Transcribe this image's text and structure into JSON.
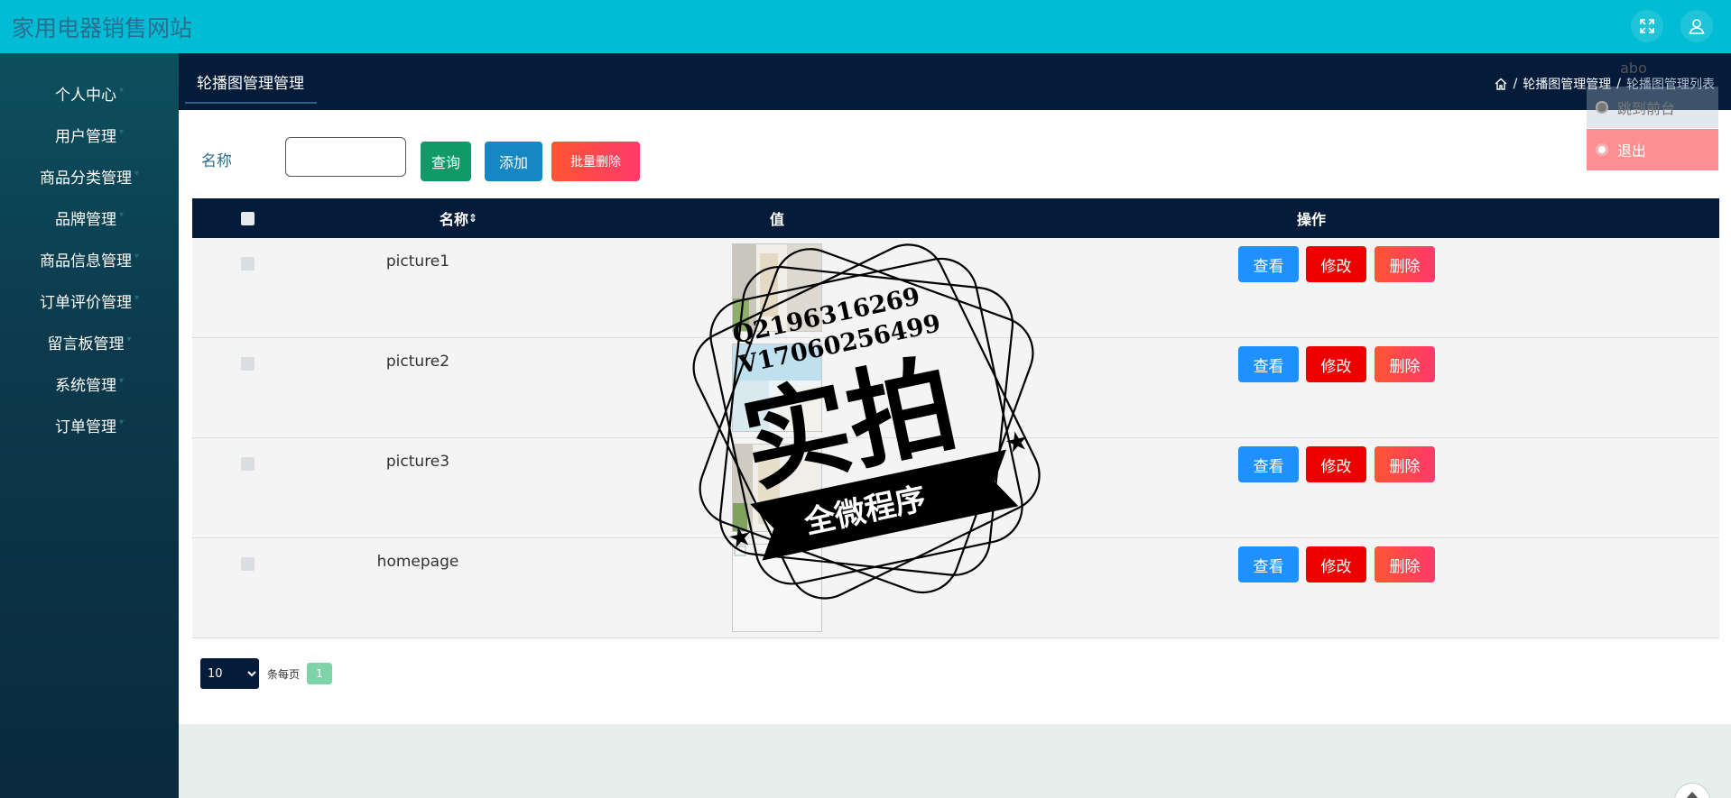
{
  "app": {
    "title": "家用电器销售网站"
  },
  "topbar": {
    "fullscreen_icon": "expand-icon",
    "user_icon": "user-icon"
  },
  "sidebar": {
    "items": [
      {
        "label": "个人中心"
      },
      {
        "label": "用户管理"
      },
      {
        "label": "商品分类管理"
      },
      {
        "label": "品牌管理"
      },
      {
        "label": "商品信息管理"
      },
      {
        "label": "订单评价管理"
      },
      {
        "label": "留言板管理"
      },
      {
        "label": "系统管理"
      },
      {
        "label": "订单管理"
      }
    ]
  },
  "header": {
    "tab": "轮播图管理管理",
    "breadcrumb": {
      "sep": "/",
      "level1": "轮播图管理管理",
      "level2": "轮播图管理列表"
    }
  },
  "search": {
    "label": "名称",
    "value": "",
    "placeholder": "",
    "query_label": "查询",
    "add_label": "添加",
    "batch_delete_label": "批量删除"
  },
  "table": {
    "headers": {
      "name": "名称",
      "sort_icon": "⇕",
      "value": "值",
      "action": "操作"
    },
    "rows": [
      {
        "name": "picture1"
      },
      {
        "name": "picture2"
      },
      {
        "name": "picture3"
      },
      {
        "name": "homepage"
      }
    ],
    "actions": {
      "view": "查看",
      "edit": "修改",
      "delete": "删除"
    }
  },
  "pagination": {
    "page_size": "10",
    "per_page_label": "条每页",
    "current_page": "1"
  },
  "user_menu": {
    "username": "abo",
    "items": [
      {
        "label": "跳到前台"
      },
      {
        "label": "退出"
      }
    ]
  },
  "watermark": {
    "line1": "Q2196316269",
    "line2": "V17060256499",
    "big": "实拍",
    "banner": "全微程序"
  },
  "colors": {
    "topbar": "#00bcd4",
    "header": "#041b3a",
    "query": "#12996a",
    "add": "#1787c4",
    "view": "#1e90ff",
    "edit": "#ee0000",
    "delete": "#ff4455",
    "logout": "#fd8f92"
  }
}
